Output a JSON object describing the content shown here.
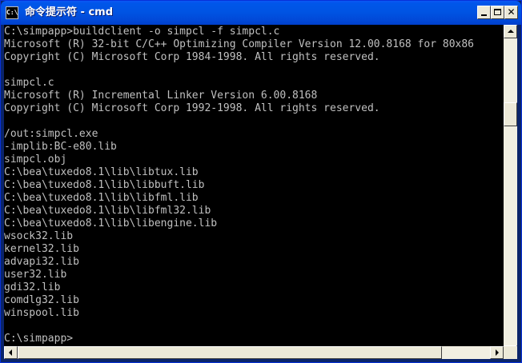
{
  "window": {
    "title": "命令提示符 - cmd",
    "icon": "console-icon",
    "icon_text": "C:\\",
    "controls": {
      "minimize": "minimize-icon",
      "maximize": "maximize-icon",
      "close": "close-icon",
      "close_glyph": "✕"
    }
  },
  "console": {
    "background": "#000000",
    "foreground": "#c0c0c0",
    "lines": [
      "C:\\simpapp>buildclient -o simpcl -f simpcl.c",
      "Microsoft (R) 32-bit C/C++ Optimizing Compiler Version 12.00.8168 for 80x86",
      "Copyright (C) Microsoft Corp 1984-1998. All rights reserved.",
      "",
      "simpcl.c",
      "Microsoft (R) Incremental Linker Version 6.00.8168",
      "Copyright (C) Microsoft Corp 1992-1998. All rights reserved.",
      "",
      "/out:simpcl.exe",
      "-implib:BC-e80.lib",
      "simpcl.obj",
      "C:\\bea\\tuxedo8.1\\lib\\libtux.lib",
      "C:\\bea\\tuxedo8.1\\lib\\libbuft.lib",
      "C:\\bea\\tuxedo8.1\\lib\\libfml.lib",
      "C:\\bea\\tuxedo8.1\\lib\\libfml32.lib",
      "C:\\bea\\tuxedo8.1\\lib\\libengine.lib",
      "wsock32.lib",
      "kernel32.lib",
      "advapi32.lib",
      "user32.lib",
      "gdi32.lib",
      "comdlg32.lib",
      "winspool.lib",
      "",
      "C:\\simpapp>"
    ]
  },
  "scrollbars": {
    "vertical": {
      "up": "arrow-up-icon",
      "down": "arrow-down-icon"
    },
    "horizontal": {
      "left": "arrow-left-icon",
      "right": "arrow-right-icon"
    }
  }
}
